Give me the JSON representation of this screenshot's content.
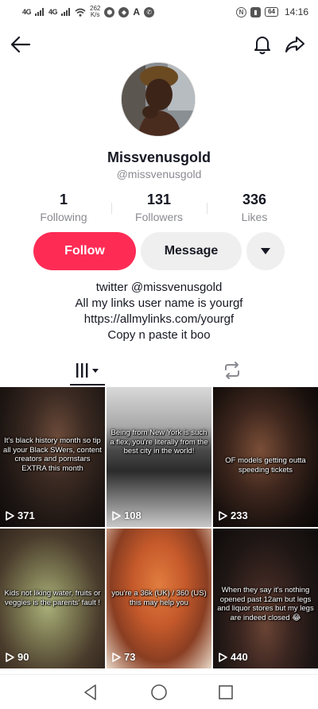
{
  "status_bar": {
    "signal_1": "4G",
    "signal_2": "4G",
    "net_speed_value": "262",
    "net_speed_unit": "K/s",
    "battery": "64",
    "time": "14:16"
  },
  "top_nav": {
    "back_icon": "back-arrow-icon",
    "bell_icon": "bell-icon",
    "share_icon": "share-icon"
  },
  "profile": {
    "display_name": "Missvenusgold",
    "username": "@missvenusgold",
    "stats": [
      {
        "value": "1",
        "label": "Following"
      },
      {
        "value": "131",
        "label": "Followers"
      },
      {
        "value": "336",
        "label": "Likes"
      }
    ],
    "follow_label": "Follow",
    "message_label": "Message",
    "bio_lines": [
      "twitter @missvenusgold",
      "All my links user name is yourgf",
      "https://allmylinks.com/yourgf",
      "Copy n paste it boo"
    ]
  },
  "tabs": {
    "videos_icon": "grid-videos-icon",
    "repost_icon": "repost-icon"
  },
  "videos": [
    {
      "caption": "It's black history month so tip all your Black SWers, content creators and pornstars EXTRA this month",
      "views": "371"
    },
    {
      "caption": "Being from New York is such a flex, you're literally from the best city in the world!",
      "views": "108"
    },
    {
      "caption": "OF models getting outta speeding tickets",
      "views": "233"
    },
    {
      "caption": "Kids not liking water, fruits or veggies is the parents' fault !",
      "views": "90"
    },
    {
      "caption": "you're a 36k (UK) / 360 (US) this may help you",
      "views": "73"
    },
    {
      "caption": "When they say it's nothing opened past 12am but legs and liquor stores but my legs are indeed closed 😂",
      "views": "440"
    }
  ],
  "colors": {
    "follow_button": "#fe2c55",
    "secondary_button": "#efefef",
    "muted_text": "#8a8b91"
  }
}
